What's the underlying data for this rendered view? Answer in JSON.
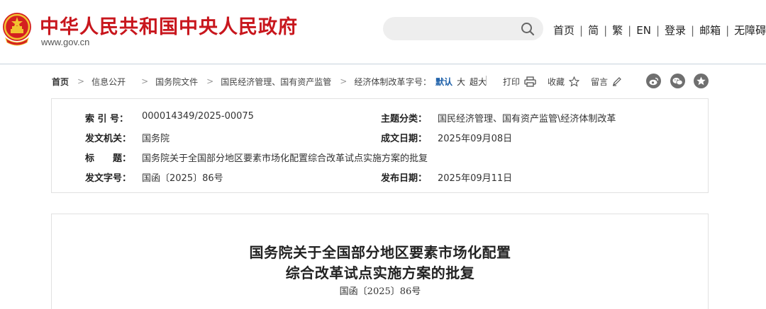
{
  "header": {
    "site_title": "中华人民共和国中央人民政府",
    "site_url": "www.gov.cn",
    "search": {
      "value": "",
      "placeholder": ""
    },
    "links": [
      "首页",
      "简",
      "繁",
      "EN",
      "登录",
      "邮箱",
      "无障碍"
    ],
    "separator": "|",
    "accent_color": "#c8161d"
  },
  "breadcrumb": {
    "items": [
      "首页",
      "信息公开",
      "国务院文件",
      "国民经济管理、国有资产监管",
      "经济体制改革"
    ],
    "separator": ">"
  },
  "font_size": {
    "label": "字号：",
    "options": [
      "默认",
      "大",
      "超大"
    ],
    "active": "默认"
  },
  "tools": {
    "print": "打印",
    "favorite": "收藏",
    "comment": "留言"
  },
  "share_icons": [
    "weibo-icon",
    "wechat-icon",
    "qzone-icon"
  ],
  "info": {
    "index_label": "索 引 号：",
    "index_value": "000014349/2025-00075",
    "topic_label": "主题分类：",
    "topic_value": "国民经济管理、国有资产监管\\经济体制改革",
    "issuer_label": "发文机关：",
    "issuer_value": "国务院",
    "created_label": "成文日期：",
    "created_value": "2025年09月08日",
    "title_label": "标　　题：",
    "title_value": "国务院关于全国部分地区要素市场化配置综合改革试点实施方案的批复",
    "docno_label": "发文字号：",
    "docno_value": "国函〔2025〕86号",
    "published_label": "发布日期：",
    "published_value": "2025年09月11日"
  },
  "document": {
    "title_line1": "国务院关于全国部分地区要素市场化配置",
    "title_line2": "综合改革试点实施方案的批复",
    "number": "国函〔2025〕86号"
  }
}
